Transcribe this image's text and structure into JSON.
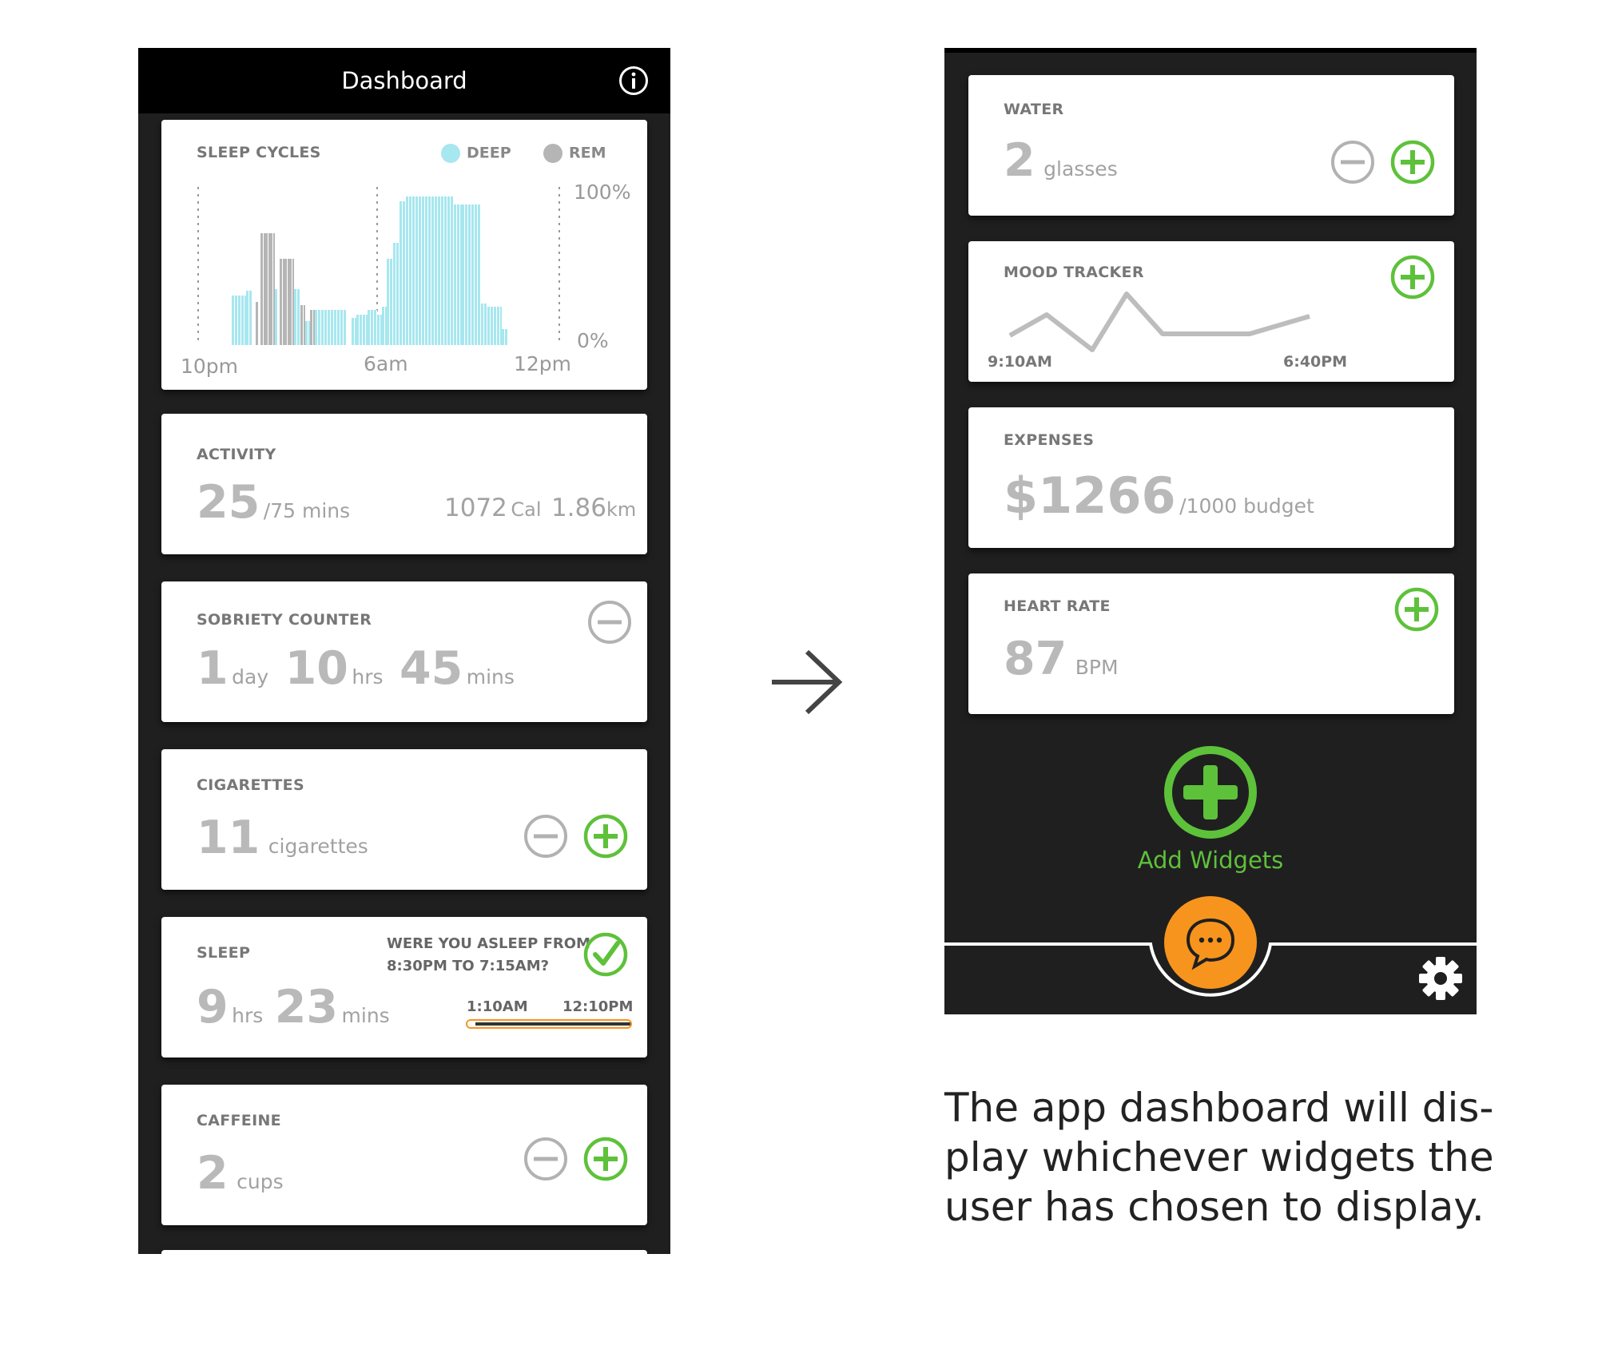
{
  "colors": {
    "deep": "#a7e7ef",
    "rem": "#b5b5b5",
    "green": "#5ec13a",
    "orange": "#f7941d",
    "dark": "#1f1f20"
  },
  "left_phone": {
    "header": {
      "title": "Dashboard",
      "info_icon": "info-icon"
    },
    "sleep_cycles": {
      "title": "SLEEP CYCLES",
      "legend": [
        {
          "label": "DEEP",
          "color": "#a7e7ef"
        },
        {
          "label": "REM",
          "color": "#b5b5b5"
        }
      ],
      "y_top_label": "100%",
      "y_bottom_label": "0%",
      "x_labels": [
        "10pm",
        "6am",
        "12pm"
      ]
    },
    "activity": {
      "title": "ACTIVITY",
      "value": "25",
      "goal": "/75 mins",
      "cal_value": "1072",
      "cal_unit": "Cal",
      "dist_value": "1.86",
      "dist_unit": "km"
    },
    "sobriety": {
      "title": "SOBRIETY COUNTER",
      "days": "1",
      "days_unit": "day",
      "hours": "10",
      "hours_unit": "hrs",
      "minutes": "45",
      "minutes_unit": "mins"
    },
    "cigarettes": {
      "title": "CIGARETTES",
      "value": "11",
      "unit": "cigarettes"
    },
    "sleep": {
      "title": "SLEEP",
      "question_line1": "WERE YOU ASLEEP FROM",
      "question_line2": "8:30PM TO 7:15AM?",
      "hours": "9",
      "hours_unit": "hrs",
      "minutes": "23",
      "minutes_unit": "mins",
      "range_start": "1:10AM",
      "range_end": "12:10PM",
      "progress": 0.03
    },
    "caffeine": {
      "title": "CAFFEINE",
      "value": "2",
      "unit": "cups"
    }
  },
  "arrow_icon": "arrow-right-icon",
  "right_phone": {
    "water": {
      "title": "WATER",
      "value": "2",
      "unit": "glasses"
    },
    "mood": {
      "title": "MOOD TRACKER",
      "time_start": "9:10AM",
      "time_end": "6:40PM"
    },
    "expenses": {
      "title": "EXPENSES",
      "value": "$1266",
      "budget": "/1000 budget"
    },
    "heart_rate": {
      "title": "HEART RATE",
      "value": "87",
      "unit": "BPM"
    },
    "add_widgets_label": "Add Widgets",
    "chat_icon": "chat-bubble-icon",
    "settings_icon": "gear-icon"
  },
  "caption": "The app dashboard will display whichever widgets the user has chosen to display."
}
